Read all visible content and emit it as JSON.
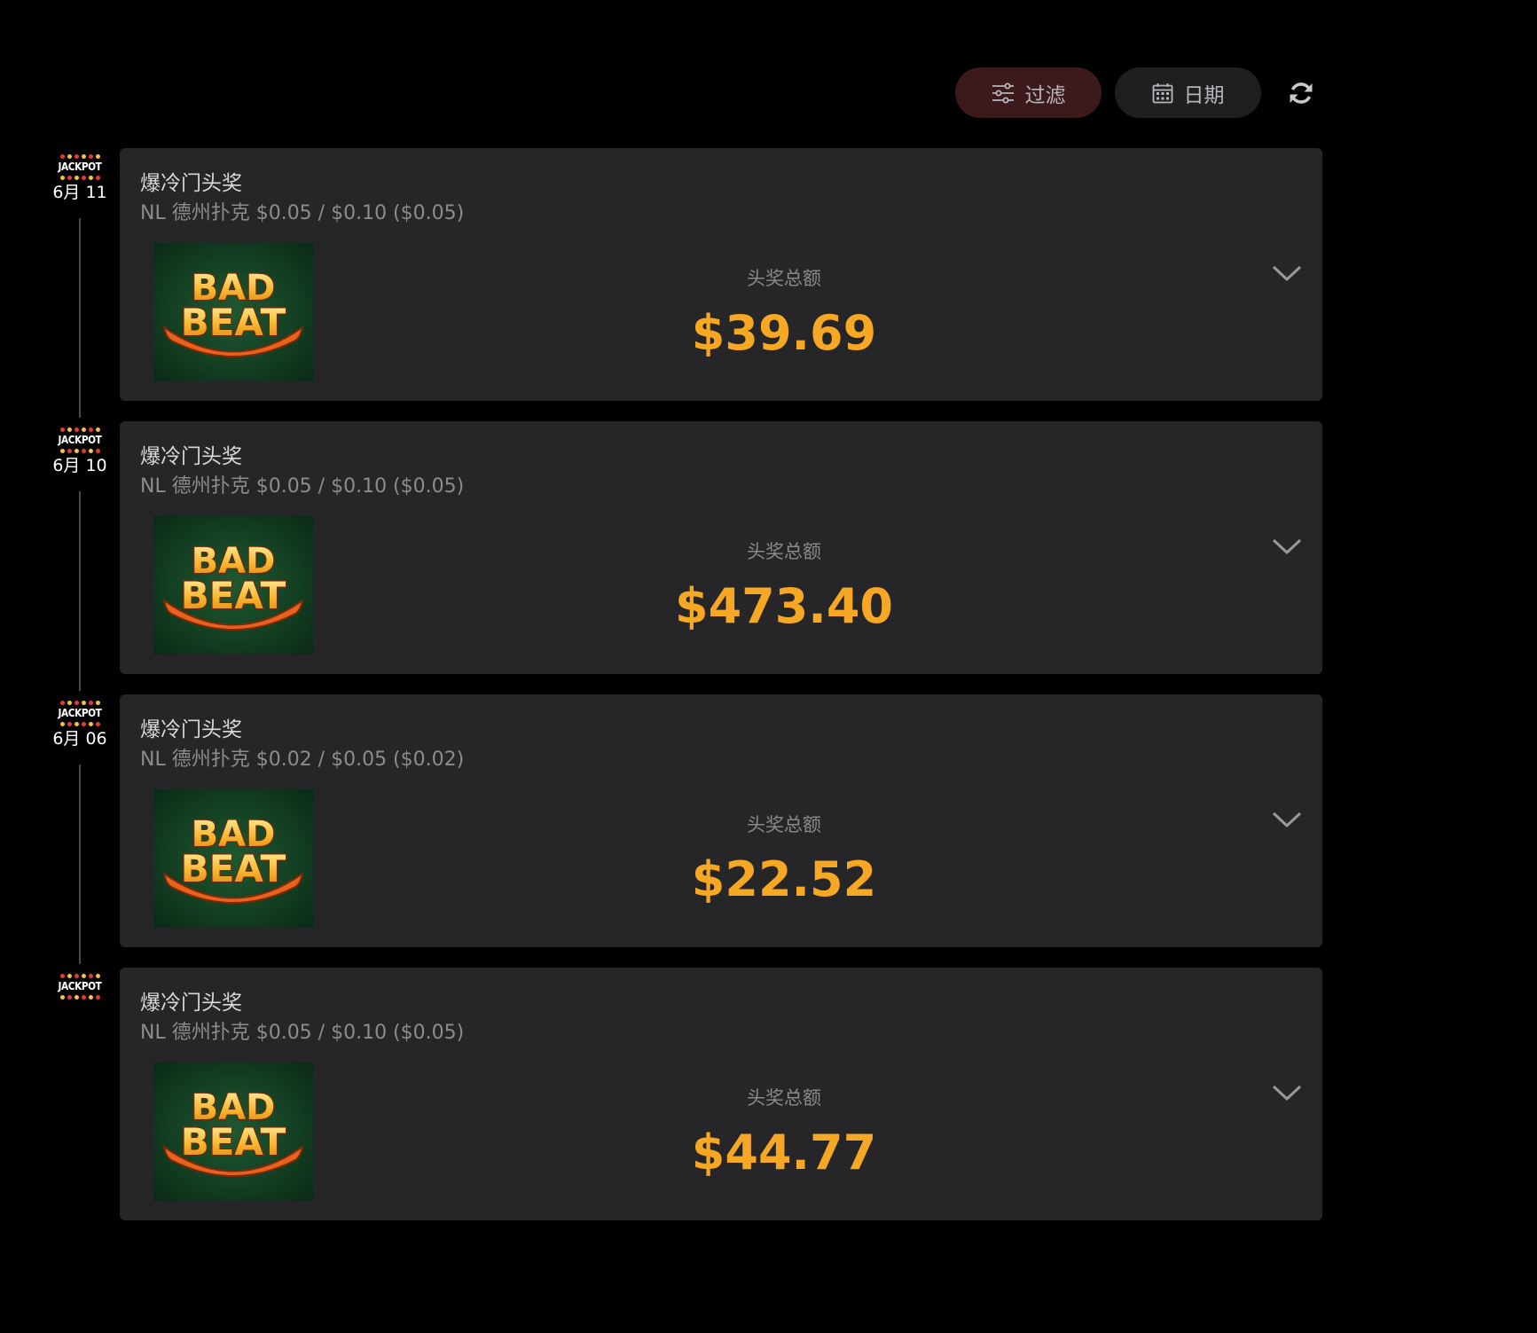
{
  "toolbar": {
    "filter_label": "过滤",
    "date_label": "日期"
  },
  "colors": {
    "background": "#000000",
    "card": "#262628",
    "amount": "#f6a723",
    "filter_bg": "#3c1a1c",
    "date_bg": "#1f1f22"
  },
  "jackpot_word": "JACKPOT",
  "thumb": {
    "line1": "BAD",
    "line2": "BEAT"
  },
  "entries": [
    {
      "date": "6月 11",
      "title": "爆冷门头奖",
      "subtitle": "NL 德州扑克 $0.05 / $0.10 ($0.05)",
      "total_label": "头奖总额",
      "amount": "$39.69"
    },
    {
      "date": "6月 10",
      "title": "爆冷门头奖",
      "subtitle": "NL 德州扑克 $0.05 / $0.10 ($0.05)",
      "total_label": "头奖总额",
      "amount": "$473.40"
    },
    {
      "date": "6月 06",
      "title": "爆冷门头奖",
      "subtitle": "NL 德州扑克 $0.02 / $0.05 ($0.02)",
      "total_label": "头奖总额",
      "amount": "$22.52"
    },
    {
      "date": "",
      "title": "爆冷门头奖",
      "subtitle": "NL 德州扑克 $0.05 / $0.10 ($0.05)",
      "total_label": "头奖总额",
      "amount": "$44.77"
    }
  ]
}
